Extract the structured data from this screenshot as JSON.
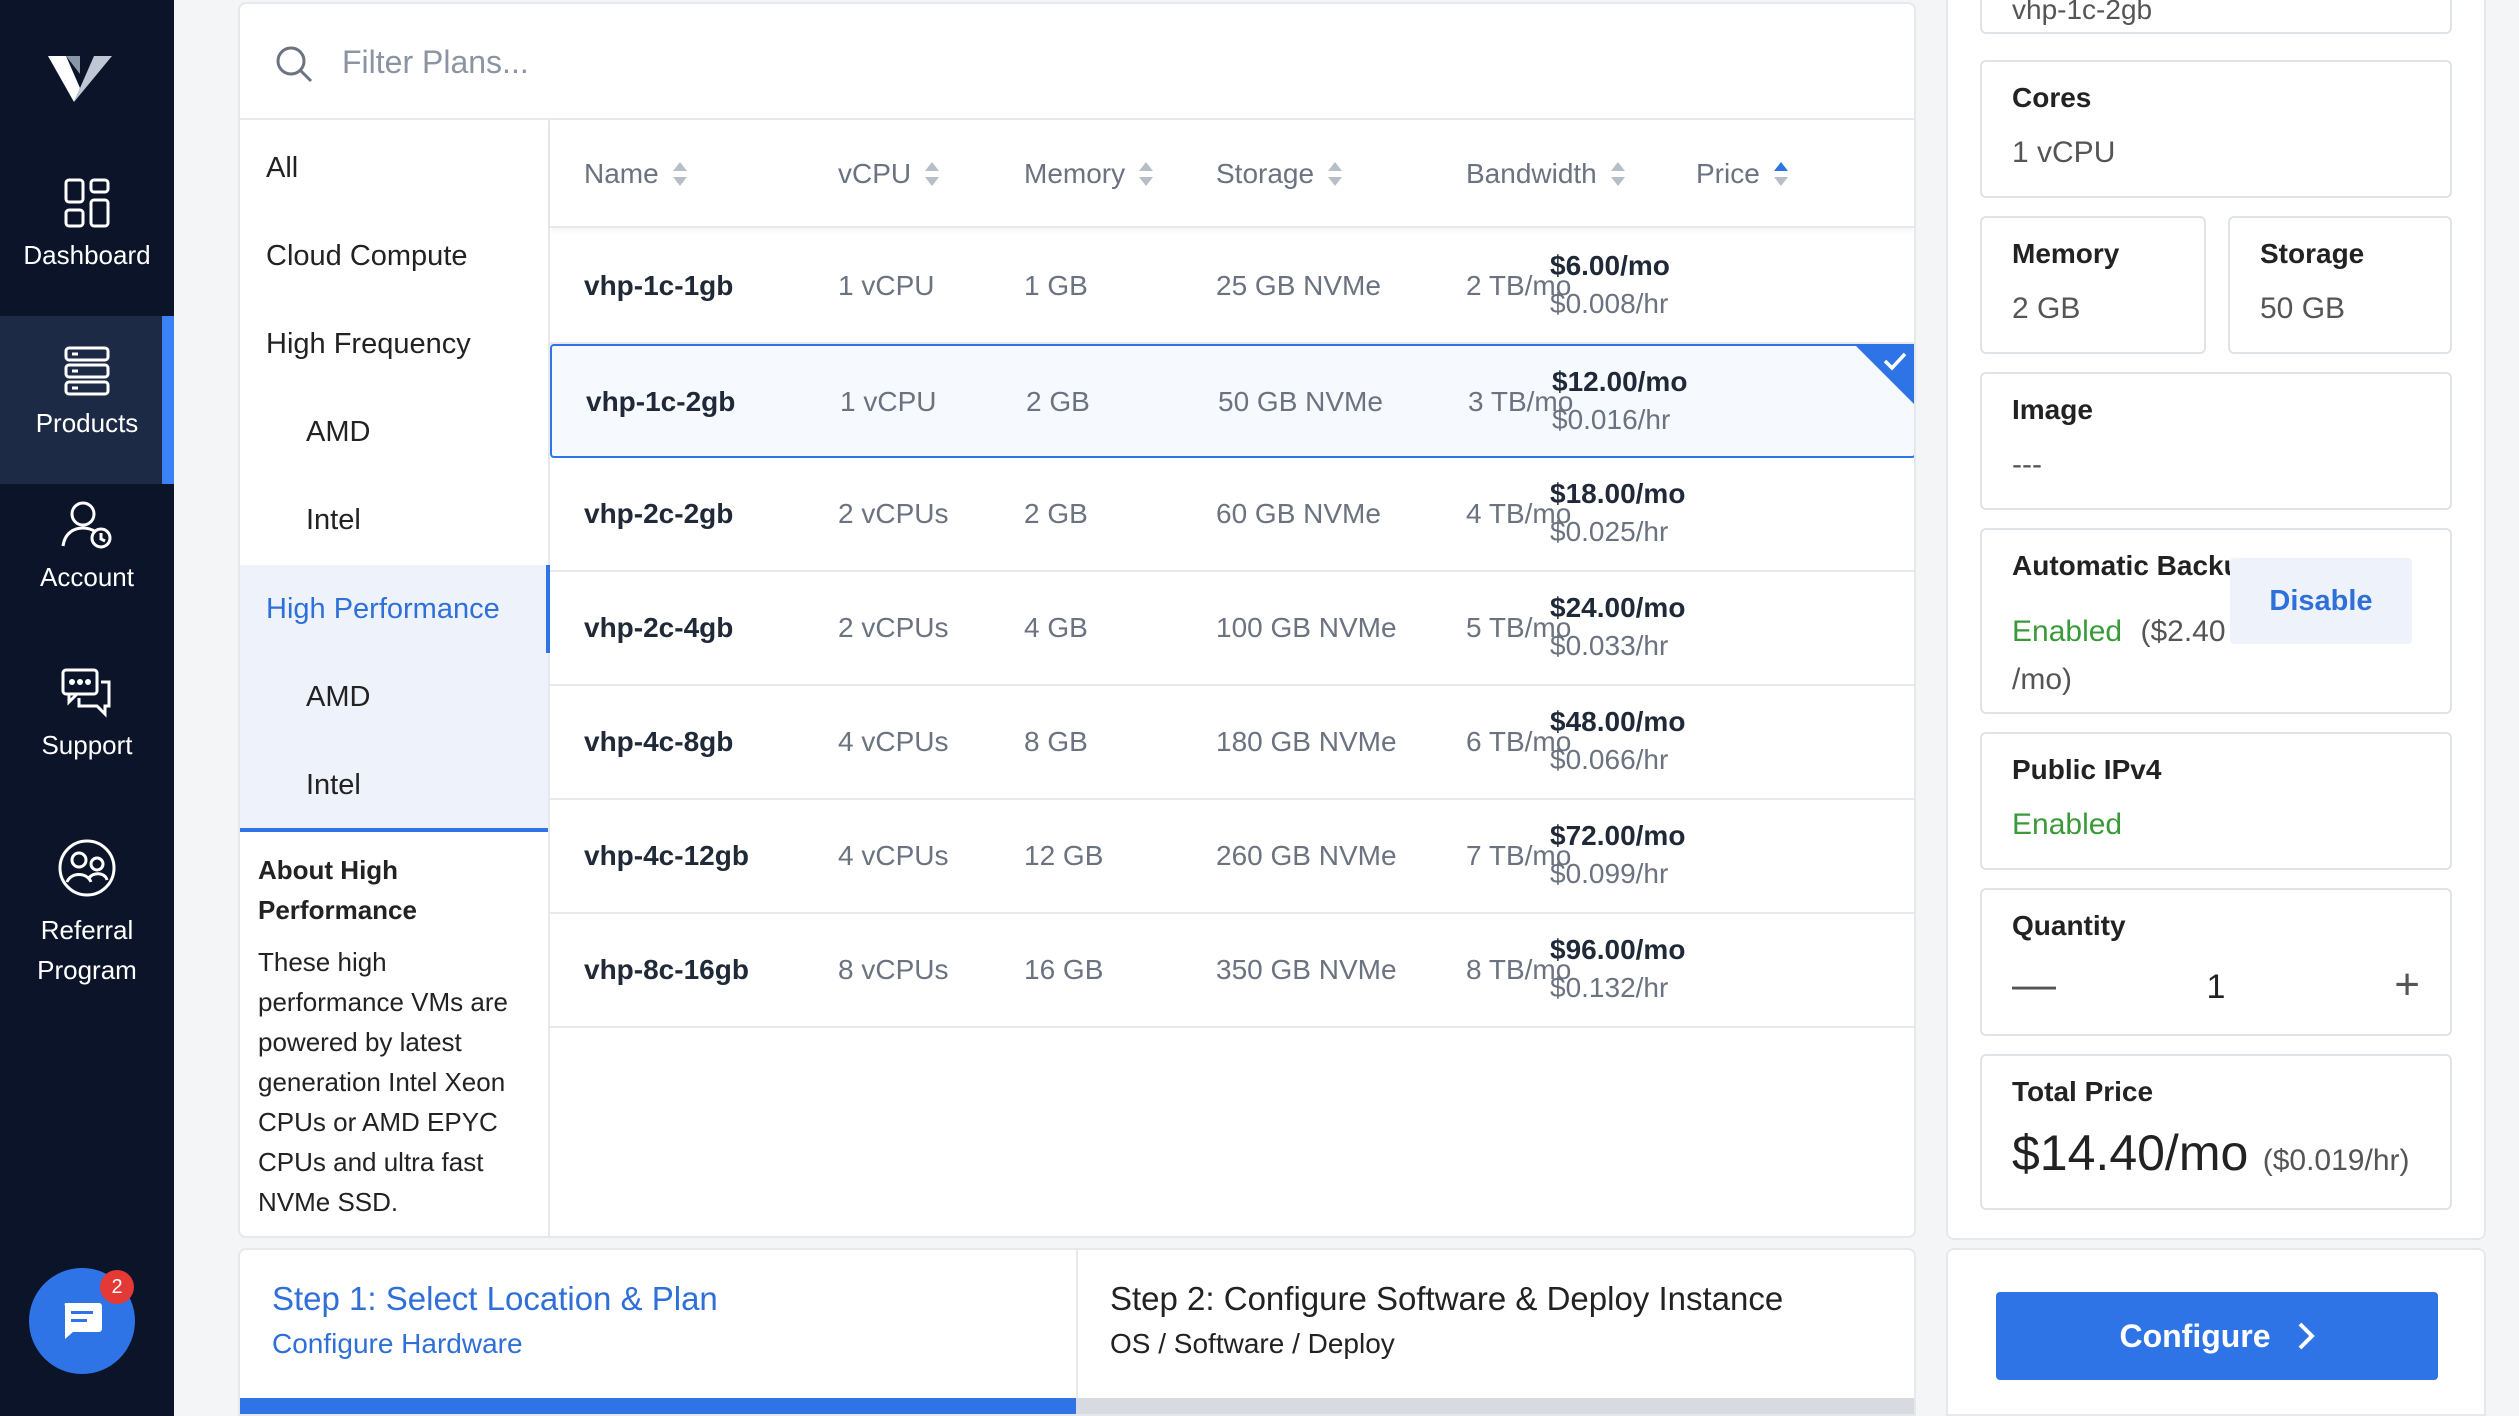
{
  "nav": {
    "items": [
      {
        "label": "Dashboard",
        "icon": "dashboard-icon"
      },
      {
        "label": "Products",
        "icon": "products-icon"
      },
      {
        "label": "Account",
        "icon": "account-icon"
      },
      {
        "label": "Support",
        "icon": "support-icon"
      },
      {
        "label": "Referral Program",
        "icon": "referral-icon"
      }
    ],
    "active": "Products",
    "chat_badge": "2"
  },
  "filter": {
    "placeholder": "Filter Plans..."
  },
  "categories": [
    {
      "label": "All"
    },
    {
      "label": "Cloud Compute"
    },
    {
      "label": "High Frequency"
    },
    {
      "label": "AMD"
    },
    {
      "label": "Intel"
    },
    {
      "label": "High Performance"
    },
    {
      "label": "AMD"
    },
    {
      "label": "Intel"
    }
  ],
  "about": {
    "title": "About High Performance",
    "text": "These high performance VMs are powered by latest generation Intel Xeon CPUs or AMD EPYC CPUs and ultra fast NVMe SSD."
  },
  "table": {
    "headers": [
      "Name",
      "vCPU",
      "Memory",
      "Storage",
      "Bandwidth",
      "Price"
    ],
    "sorted_by": "Price",
    "rows": [
      {
        "name": "vhp-1c-1gb",
        "vcpu": "1 vCPU",
        "memory": "1 GB",
        "storage": "25 GB NVMe",
        "bandwidth": "2 TB/mo",
        "price_mo": "$6.00/mo",
        "price_hr": "$0.008/hr"
      },
      {
        "name": "vhp-1c-2gb",
        "vcpu": "1 vCPU",
        "memory": "2 GB",
        "storage": "50 GB NVMe",
        "bandwidth": "3 TB/mo",
        "price_mo": "$12.00/mo",
        "price_hr": "$0.016/hr"
      },
      {
        "name": "vhp-2c-2gb",
        "vcpu": "2 vCPUs",
        "memory": "2 GB",
        "storage": "60 GB NVMe",
        "bandwidth": "4 TB/mo",
        "price_mo": "$18.00/mo",
        "price_hr": "$0.025/hr"
      },
      {
        "name": "vhp-2c-4gb",
        "vcpu": "2 vCPUs",
        "memory": "4 GB",
        "storage": "100 GB NVMe",
        "bandwidth": "5 TB/mo",
        "price_mo": "$24.00/mo",
        "price_hr": "$0.033/hr"
      },
      {
        "name": "vhp-4c-8gb",
        "vcpu": "4 vCPUs",
        "memory": "8 GB",
        "storage": "180 GB NVMe",
        "bandwidth": "6 TB/mo",
        "price_mo": "$48.00/mo",
        "price_hr": "$0.066/hr"
      },
      {
        "name": "vhp-4c-12gb",
        "vcpu": "4 vCPUs",
        "memory": "12 GB",
        "storage": "260 GB NVMe",
        "bandwidth": "7 TB/mo",
        "price_mo": "$72.00/mo",
        "price_hr": "$0.099/hr"
      },
      {
        "name": "vhp-8c-16gb",
        "vcpu": "8 vCPUs",
        "memory": "16 GB",
        "storage": "350 GB NVMe",
        "bandwidth": "8 TB/mo",
        "price_mo": "$96.00/mo",
        "price_hr": "$0.132/hr"
      }
    ]
  },
  "steps": [
    {
      "title": "Step 1: Select Location & Plan",
      "subtitle": "Configure Hardware"
    },
    {
      "title": "Step 2: Configure Software & Deploy Instance",
      "subtitle": "OS / Software / Deploy"
    }
  ],
  "summary": {
    "plan": "vhp-1c-2gb",
    "cores": {
      "label": "Cores",
      "value": "1 vCPU"
    },
    "memory": {
      "label": "Memory",
      "value": "2 GB"
    },
    "storage": {
      "label": "Storage",
      "value": "50 GB"
    },
    "image": {
      "label": "Image",
      "value": "---"
    },
    "backups": {
      "label": "Automatic Backu",
      "status": "Enabled",
      "price": "($2.40",
      "price2": "/mo)",
      "button": "Disable"
    },
    "ipv4": {
      "label": "Public IPv4",
      "value": "Enabled"
    },
    "quantity": {
      "label": "Quantity",
      "value": "1"
    },
    "total": {
      "label": "Total Price",
      "value": "$14.40/mo",
      "hourly": "($0.019/hr)"
    }
  },
  "configure_label": "Configure",
  "colors": {
    "accent": "#2f74e6",
    "nav_bg": "#0b1429",
    "enabled": "#3a9a3a"
  }
}
